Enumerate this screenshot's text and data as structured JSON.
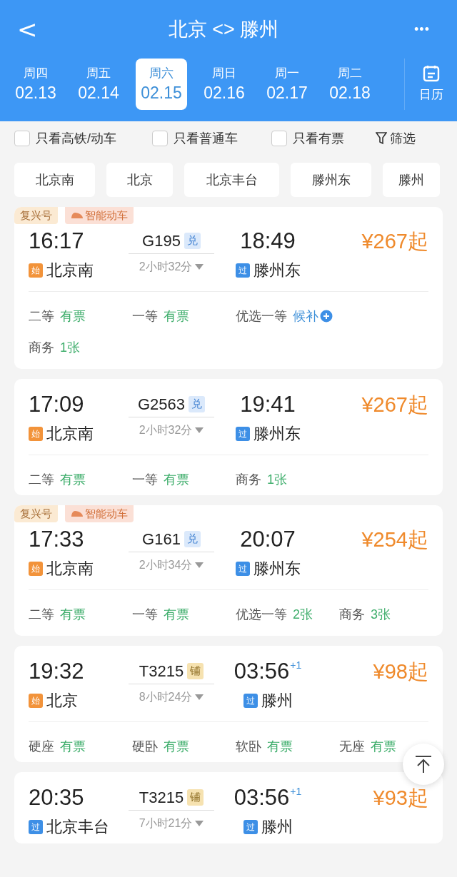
{
  "header": {
    "back": "<",
    "title": "北京 <> 滕州",
    "more": "•••"
  },
  "dates": [
    {
      "weekday": "周四",
      "date": "02.13",
      "selected": false
    },
    {
      "weekday": "周五",
      "date": "02.14",
      "selected": false
    },
    {
      "weekday": "周六",
      "date": "02.15",
      "selected": true
    },
    {
      "weekday": "周日",
      "date": "02.16",
      "selected": false
    },
    {
      "weekday": "周一",
      "date": "02.17",
      "selected": false
    },
    {
      "weekday": "周二",
      "date": "02.18",
      "selected": false
    }
  ],
  "calendar": {
    "label": "日历"
  },
  "filters": [
    {
      "label": "只看高铁/动车",
      "checked": false
    },
    {
      "label": "只看普通车",
      "checked": false
    },
    {
      "label": "只看有票",
      "checked": false
    }
  ],
  "filter_button": {
    "label": "筛选"
  },
  "stations": [
    "北京南",
    "北京",
    "北京丰台",
    "滕州东",
    "滕州"
  ],
  "trains": [
    {
      "tags": [
        "复兴号",
        "智能动车"
      ],
      "depart_time": "16:17",
      "depart_badge": {
        "kind": "start",
        "text": "始"
      },
      "depart_station": "北京南",
      "train_no": "G195",
      "train_badge": {
        "kind": "exchange",
        "text": "兑"
      },
      "duration": "2小时32分",
      "arrive_time": "18:49",
      "arrive_badge": {
        "kind": "pass",
        "text": "过"
      },
      "arrive_station": "滕州东",
      "price": "¥267起",
      "seat_rows": [
        [
          {
            "name": "二等",
            "status": "有票",
            "kind": "available"
          },
          {
            "name": "一等",
            "status": "有票",
            "kind": "available"
          },
          {
            "name": "优选一等",
            "status": "候补",
            "kind": "waitlist"
          }
        ],
        [
          {
            "name": "商务",
            "status": "1张",
            "kind": "available"
          }
        ]
      ]
    },
    {
      "depart_time": "17:09",
      "depart_badge": {
        "kind": "start",
        "text": "始"
      },
      "depart_station": "北京南",
      "train_no": "G2563",
      "train_badge": {
        "kind": "exchange",
        "text": "兑"
      },
      "duration": "2小时32分",
      "arrive_time": "19:41",
      "arrive_badge": {
        "kind": "pass",
        "text": "过"
      },
      "arrive_station": "滕州东",
      "price": "¥267起",
      "seat_rows": [
        [
          {
            "name": "二等",
            "status": "有票",
            "kind": "available"
          },
          {
            "name": "一等",
            "status": "有票",
            "kind": "available"
          },
          {
            "name": "商务",
            "status": "1张",
            "kind": "available"
          }
        ]
      ]
    },
    {
      "tags": [
        "复兴号",
        "智能动车"
      ],
      "depart_time": "17:33",
      "depart_badge": {
        "kind": "start",
        "text": "始"
      },
      "depart_station": "北京南",
      "train_no": "G161",
      "train_badge": {
        "kind": "exchange",
        "text": "兑"
      },
      "duration": "2小时34分",
      "arrive_time": "20:07",
      "arrive_badge": {
        "kind": "pass",
        "text": "过"
      },
      "arrive_station": "滕州东",
      "price": "¥254起",
      "seat_rows": [
        [
          {
            "name": "二等",
            "status": "有票",
            "kind": "available"
          },
          {
            "name": "一等",
            "status": "有票",
            "kind": "available"
          },
          {
            "name": "优选一等",
            "status": "2张",
            "kind": "available"
          },
          {
            "name": "商务",
            "status": "3张",
            "kind": "available"
          }
        ]
      ]
    },
    {
      "depart_time": "19:32",
      "depart_badge": {
        "kind": "start",
        "text": "始"
      },
      "depart_station": "北京",
      "train_no": "T3215",
      "train_badge": {
        "kind": "berth",
        "text": "铺"
      },
      "duration": "8小时24分",
      "arrive_time": "03:56",
      "next_day": "+1",
      "arrive_badge": {
        "kind": "pass",
        "text": "过"
      },
      "arrive_station": "滕州",
      "price": "¥98起",
      "seat_rows": [
        [
          {
            "name": "硬座",
            "status": "有票",
            "kind": "available"
          },
          {
            "name": "硬卧",
            "status": "有票",
            "kind": "available"
          },
          {
            "name": "软卧",
            "status": "有票",
            "kind": "available"
          },
          {
            "name": "无座",
            "status": "有票",
            "kind": "available"
          }
        ]
      ]
    },
    {
      "depart_time": "20:35",
      "depart_badge": {
        "kind": "pass",
        "text": "过"
      },
      "depart_station": "北京丰台",
      "train_no": "T3215",
      "train_badge": {
        "kind": "berth",
        "text": "铺"
      },
      "duration": "7小时21分",
      "arrive_time": "03:56",
      "next_day": "+1",
      "arrive_badge": {
        "kind": "pass",
        "text": "过"
      },
      "arrive_station": "滕州",
      "price": "¥93起"
    }
  ]
}
